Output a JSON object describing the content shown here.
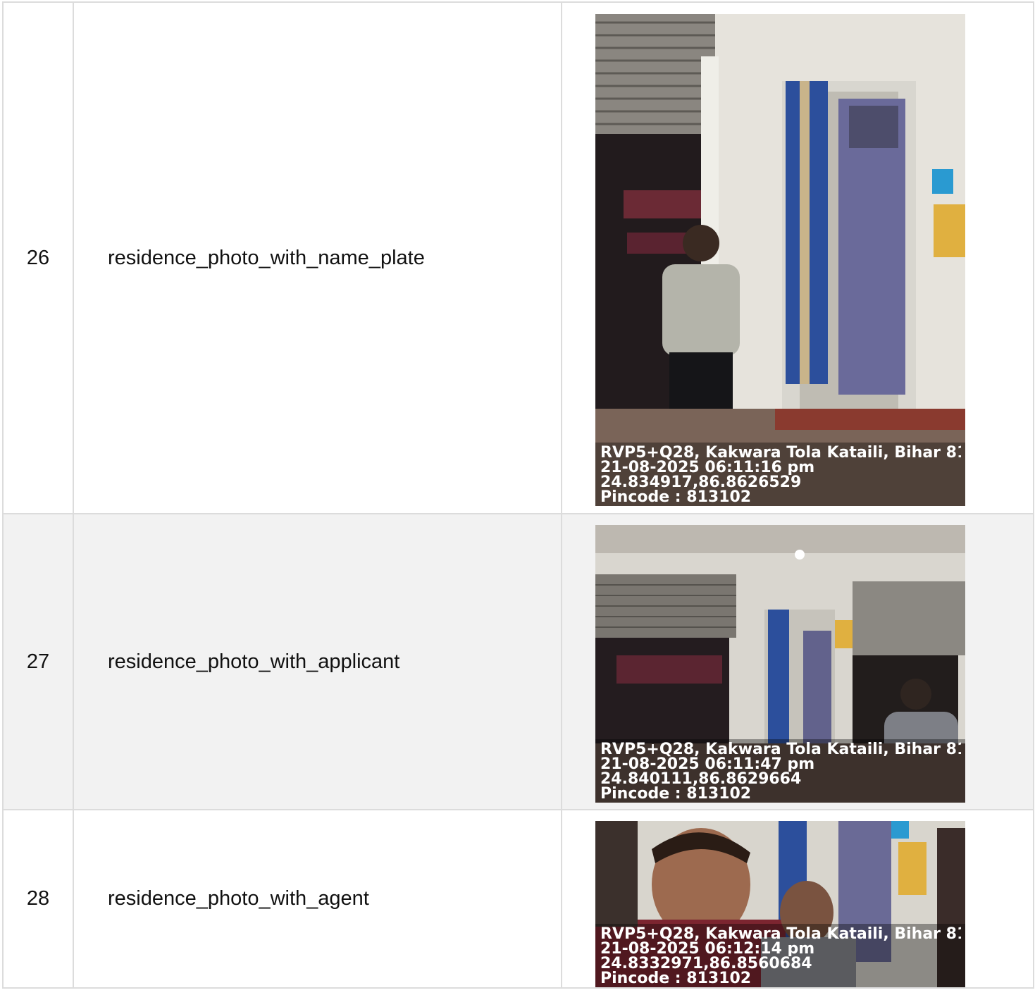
{
  "rows": [
    {
      "num": "26",
      "name": "residence_photo_with_name_plate",
      "photo": {
        "description_icon": "residence-photo",
        "address": "RVP5+Q28, Kakwara Tola Kataili, Bihar 81",
        "datetime": "21-08-2025 06:11:16 pm",
        "coords": "24.834917,86.8626529",
        "pincode": "Pincode : 813102"
      }
    },
    {
      "num": "27",
      "name": "residence_photo_with_applicant",
      "photo": {
        "description_icon": "residence-photo",
        "address": "RVP5+Q28, Kakwara Tola Kataili, Bihar 81",
        "datetime": "21-08-2025 06:11:47 pm",
        "coords": "24.840111,86.8629664",
        "pincode": "Pincode : 813102"
      }
    },
    {
      "num": "28",
      "name": "residence_photo_with_agent",
      "photo": {
        "description_icon": "selfie-photo",
        "address": "RVP5+Q28, Kakwara Tola Kataili, Bihar 81",
        "datetime": "21-08-2025 06:12:14 pm",
        "coords": "24.8332971,86.8560684",
        "pincode": "Pincode : 813102"
      }
    }
  ]
}
